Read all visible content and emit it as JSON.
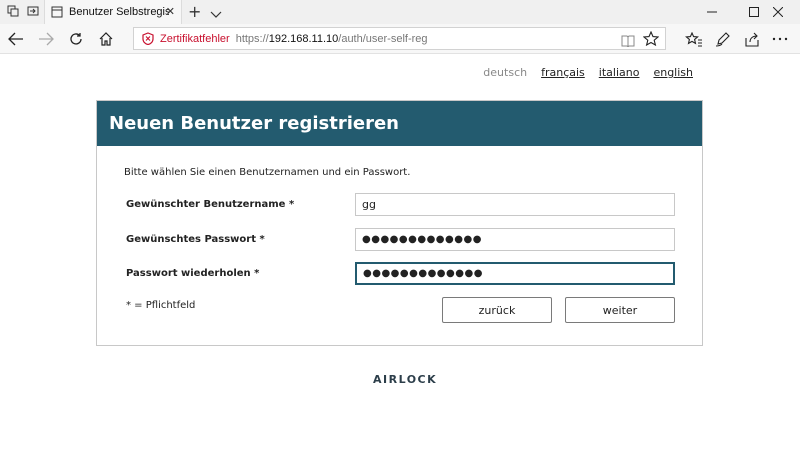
{
  "browser": {
    "tab_title": "Benutzer Selbstregistrie",
    "cert_warning": "Zertifikatfehler",
    "url_protocol": "https://",
    "url_host": "192.168.11.10",
    "url_path": "/auth/user-self-reg"
  },
  "languages": {
    "current": "deutsch",
    "links": [
      "français",
      "italiano",
      "english"
    ]
  },
  "form": {
    "title": "Neuen Benutzer registrieren",
    "intro": "Bitte wählen Sie einen Benutzernamen und ein Passwort.",
    "username_label": "Gewünschter Benutzername *",
    "username_value": "gg",
    "password_label": "Gewünschtes Passwort *",
    "password_value": "●●●●●●●●●●●●●",
    "password_repeat_label": "Passwort wiederholen *",
    "password_repeat_value": "●●●●●●●●●●●●●",
    "required_note": "*  = Pflichtfeld",
    "back_button": "zurück",
    "next_button": "weiter"
  },
  "footer": {
    "logo_text": "AIRLOCK"
  },
  "colors": {
    "header_bg": "#235b6f",
    "cert_error": "#c8102e"
  }
}
